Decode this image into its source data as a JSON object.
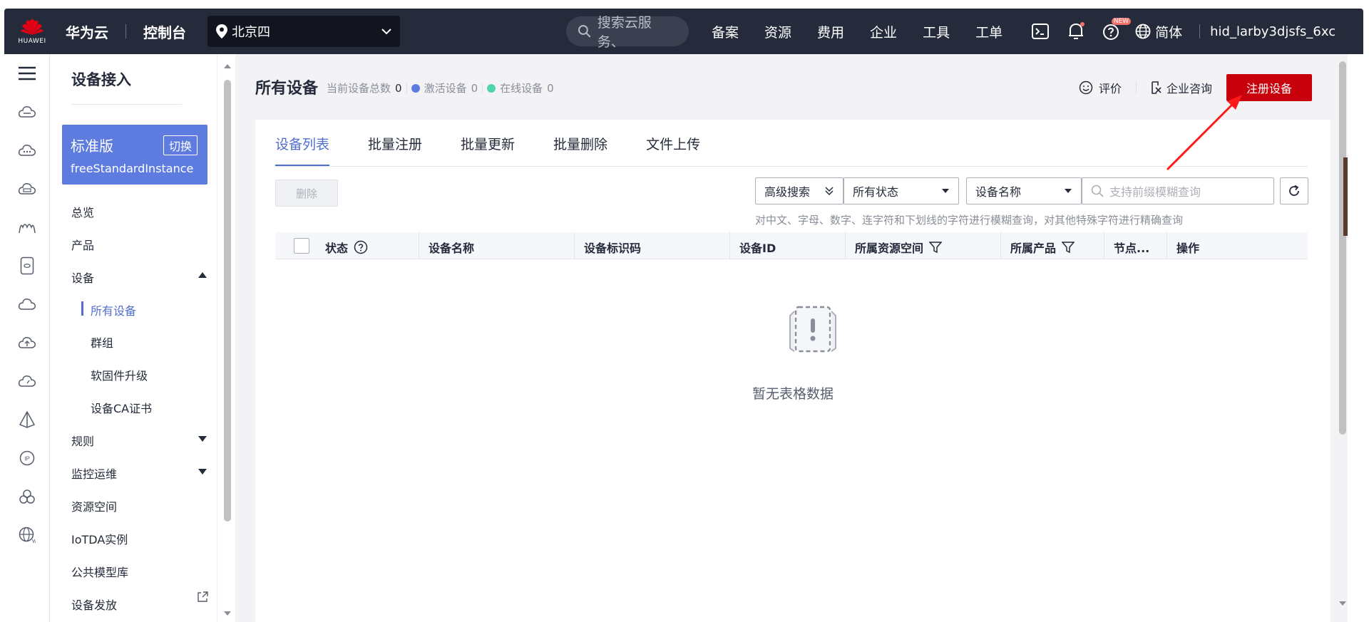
{
  "topbar": {
    "logo_word": "HUAWEI",
    "brand": "华为云",
    "console": "控制台",
    "region": "北京四",
    "search_placeholder": "搜索云服务、",
    "nav": [
      "备案",
      "资源",
      "费用",
      "企业",
      "工具",
      "工单"
    ],
    "badge_new": "NEW",
    "lang": "简体",
    "user": "hid_larby3djsfs_6xc"
  },
  "sidebar": {
    "title": "设备接入",
    "edition": {
      "name": "标准版",
      "switch": "切换",
      "instance": "freeStandardInstance"
    },
    "items": {
      "overview": "总览",
      "product": "产品",
      "device": "设备",
      "rules": "规则",
      "monitor": "监控运维",
      "resource_space": "资源空间",
      "iotda_instance": "IoTDA实例",
      "model_lib": "公共模型库",
      "provisioning": "设备发放"
    },
    "sub_items": {
      "all_devices": "所有设备",
      "groups": "群组",
      "firmware": "软固件升级",
      "ca_cert": "设备CA证书"
    }
  },
  "main": {
    "title": "所有设备",
    "stats": {
      "total_label": "当前设备总数",
      "total": "0",
      "active_label": "激活设备",
      "active": "0",
      "online_label": "在线设备",
      "online": "0"
    },
    "actions": {
      "rate": "评价",
      "consult": "企业咨询",
      "register": "注册设备"
    },
    "tabs": [
      "设备列表",
      "批量注册",
      "批量更新",
      "批量删除",
      "文件上传"
    ],
    "delete_button": "删除",
    "filters": {
      "advanced": "高级搜索",
      "status": "所有状态",
      "field": "设备名称",
      "search_placeholder": "支持前缀模糊查询"
    },
    "hint": "对中文、字母、数字、连字符和下划线的字符进行模糊查询，对其他特殊字符进行精确查询",
    "columns": [
      "状态",
      "设备名称",
      "设备标识码",
      "设备ID",
      "所属资源空间",
      "所属产品",
      "节点...",
      "操作"
    ],
    "empty_text": "暂无表格数据"
  },
  "colors": {
    "topbar": "#252b3a",
    "accent": "#526ecc",
    "edition": "#5e7ce0",
    "register": "#c7000b",
    "active_dot": "#5e7ce0",
    "online_dot": "#50d4ab"
  }
}
